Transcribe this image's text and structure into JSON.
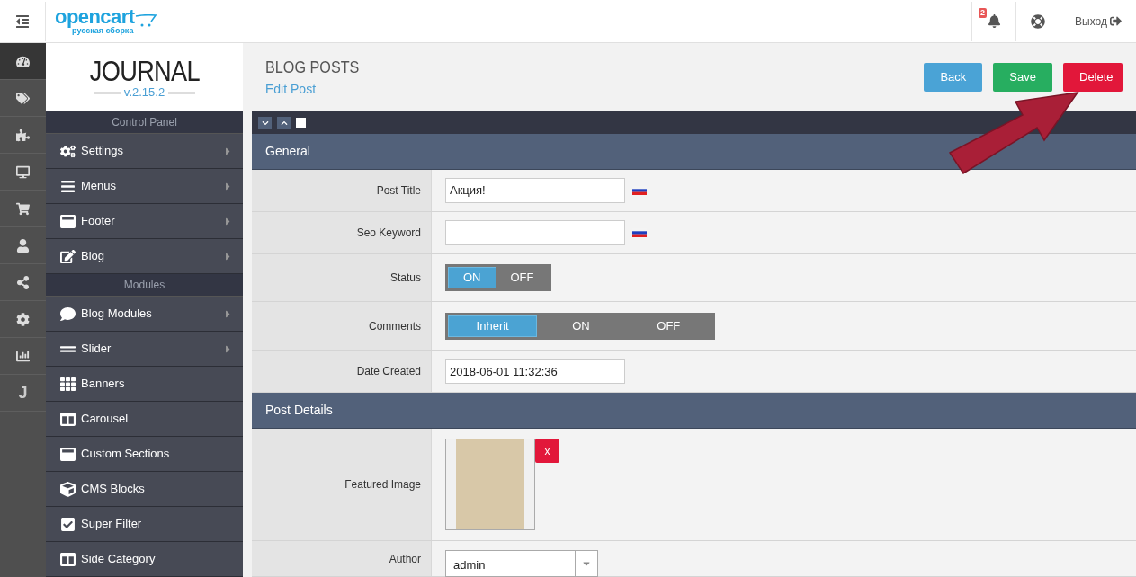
{
  "topbar": {
    "logo": "opencart",
    "logo_sub": "русская сборка",
    "notifications": "2",
    "logout": "Выход"
  },
  "rail": [
    {
      "kind": "dashboard",
      "selected": true
    },
    {
      "kind": "tags",
      "selected": false
    },
    {
      "kind": "puzzle",
      "selected": false
    },
    {
      "kind": "desktop",
      "selected": false
    },
    {
      "kind": "cart",
      "selected": false
    },
    {
      "kind": "user",
      "selected": false
    },
    {
      "kind": "share",
      "selected": false
    },
    {
      "kind": "cog",
      "selected": false
    },
    {
      "kind": "chart",
      "selected": false
    },
    {
      "kind": "letter",
      "label": "J",
      "selected": false
    }
  ],
  "brand": {
    "name": "JOURNAL",
    "version": "v.2.15.2"
  },
  "sidebar": [
    {
      "title": "Control Panel",
      "items": [
        {
          "kind": "cogs",
          "label": "Settings",
          "submenu": true
        },
        {
          "kind": "bars",
          "label": "Menus",
          "submenu": true
        },
        {
          "kind": "footer",
          "label": "Footer",
          "submenu": true
        },
        {
          "kind": "edit",
          "label": "Blog",
          "submenu": true
        }
      ]
    },
    {
      "title": "Modules",
      "items": [
        {
          "kind": "comment",
          "label": "Blog Modules",
          "submenu": true
        },
        {
          "kind": "slider",
          "label": "Slider",
          "submenu": true
        },
        {
          "kind": "grid",
          "label": "Banners",
          "submenu": false
        },
        {
          "kind": "carousel",
          "label": "Carousel",
          "submenu": false
        },
        {
          "kind": "sections",
          "label": "Custom Sections",
          "submenu": false
        },
        {
          "kind": "cube",
          "label": "CMS Blocks",
          "submenu": false
        },
        {
          "kind": "check",
          "label": "Super Filter",
          "submenu": false
        },
        {
          "kind": "column",
          "label": "Side Category",
          "submenu": false
        }
      ]
    }
  ],
  "toolbar": {
    "checked": false
  },
  "page": {
    "title": "BLOG POSTS",
    "subtitle": "Edit Post",
    "buttons": [
      {
        "kind": "back",
        "label": "Back"
      },
      {
        "kind": "save",
        "label": "Save"
      },
      {
        "kind": "delete",
        "label": "Delete"
      }
    ]
  },
  "sections": [
    {
      "title": "General",
      "rows": [
        {
          "kind": "text",
          "label": "Post Title",
          "value": "Акция!",
          "flag": true
        },
        {
          "kind": "text",
          "label": "Seo Keyword",
          "value": "",
          "flag": true
        },
        {
          "kind": "toggle",
          "label": "Status",
          "options": [
            {
              "label": "ON",
              "selected": true
            },
            {
              "label": "OFF",
              "selected": false
            }
          ]
        },
        {
          "kind": "toggle",
          "label": "Comments",
          "options": [
            {
              "label": "Inherit",
              "selected": true
            },
            {
              "label": "ON",
              "selected": false
            },
            {
              "label": "OFF",
              "selected": false
            }
          ]
        },
        {
          "kind": "text",
          "label": "Date Created",
          "value": "2018-06-01 11:32:36",
          "flag": false
        }
      ]
    },
    {
      "title": "Post Details",
      "rows": [
        {
          "kind": "image",
          "label": "Featured Image",
          "remove": "x"
        },
        {
          "kind": "select",
          "label": "Author",
          "value": "admin"
        }
      ]
    }
  ]
}
